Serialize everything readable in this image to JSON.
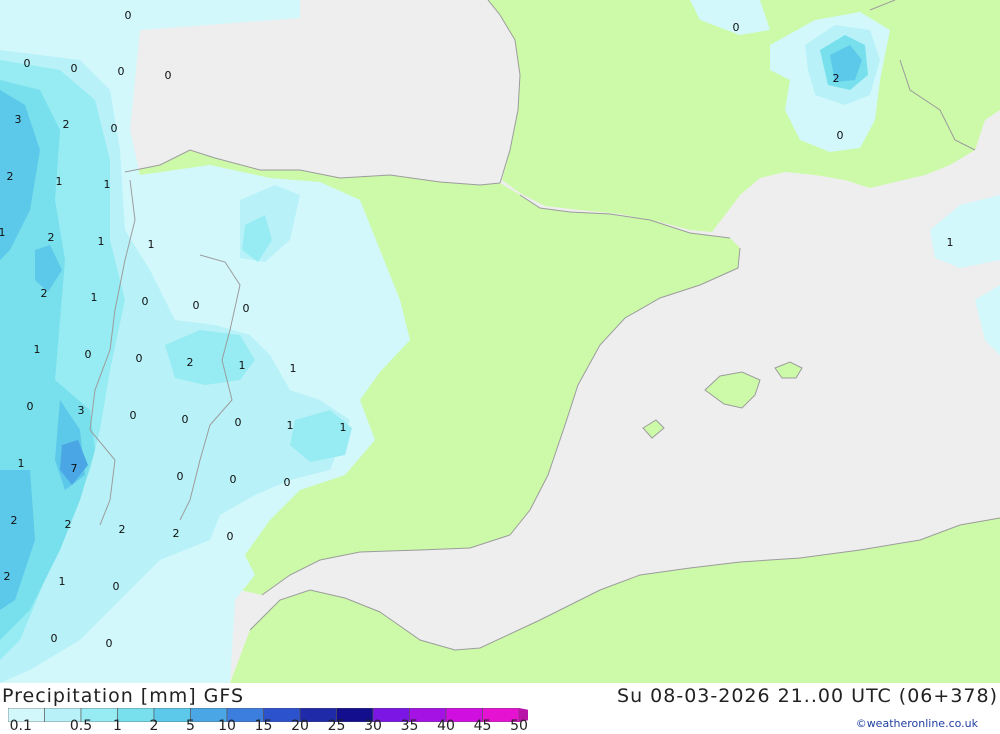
{
  "footer": {
    "legend_title": "Precipitation [mm] GFS",
    "valid_time": "Su 08-03-2026 21..00 UTC (06+378)",
    "credit": "©weatheronline.co.uk"
  },
  "legend": {
    "ticks": [
      "0.1",
      "0.5",
      "1",
      "2",
      "5",
      "10",
      "15",
      "20",
      "25",
      "30",
      "35",
      "40",
      "45",
      "50"
    ],
    "colors": [
      "#d2f8fc",
      "#b8f2f8",
      "#96ecf2",
      "#78dfec",
      "#5cc8ea",
      "#4aa6e4",
      "#3c7ede",
      "#2c52ce",
      "#1e2aa8",
      "#130e8e",
      "#7c16e4",
      "#a412e4",
      "#d00ee0",
      "#e612d2",
      "#b814a8"
    ]
  },
  "colors": {
    "land": "#ccfaa8",
    "sea": "#eeeeee",
    "border": "#9c9c9c"
  },
  "map": {
    "value_labels": [
      "0",
      "0",
      "0",
      "0",
      "0",
      "3",
      "2",
      "0",
      "2",
      "1",
      "1",
      "1",
      "2",
      "1",
      "1",
      "2",
      "1",
      "0",
      "0",
      "0",
      "1",
      "0",
      "0",
      "2",
      "1",
      "1",
      "0",
      "3",
      "0",
      "0",
      "0",
      "1",
      "1",
      "1",
      "7",
      "0",
      "0",
      "0",
      "2",
      "2",
      "2",
      "2",
      "0",
      "2",
      "1",
      "0",
      "0",
      "0",
      "0",
      "2",
      "0",
      "1"
    ]
  }
}
